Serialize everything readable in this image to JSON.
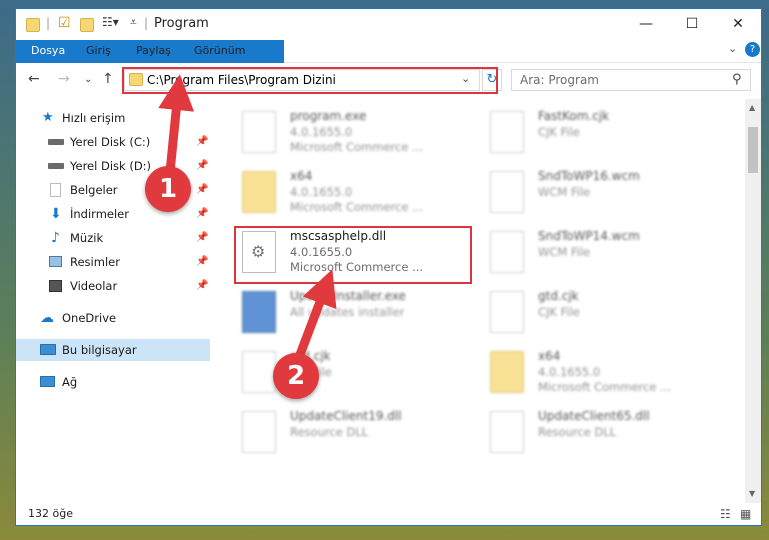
{
  "window": {
    "title": "Program"
  },
  "ribbon": {
    "tabs": [
      "Dosya",
      "Giriş",
      "Paylaş",
      "Görünüm"
    ]
  },
  "address": {
    "path": "C:\\Program Files\\Program Dizini"
  },
  "search": {
    "placeholder": "Ara: Program"
  },
  "sidebar": {
    "items": [
      {
        "label": "Hızlı erişim",
        "pinned": false
      },
      {
        "label": "Yerel Disk (C:)",
        "pinned": true
      },
      {
        "label": "Yerel Disk (D:)",
        "pinned": true
      },
      {
        "label": "Belgeler",
        "pinned": true
      },
      {
        "label": "İndirmeler",
        "pinned": true
      },
      {
        "label": "Müzik",
        "pinned": true
      },
      {
        "label": "Resimler",
        "pinned": true
      },
      {
        "label": "Videolar",
        "pinned": true
      },
      {
        "label": "OneDrive",
        "pinned": false
      },
      {
        "label": "Bu bilgisayar",
        "pinned": false,
        "selected": true
      },
      {
        "label": "Ağ",
        "pinned": false
      }
    ]
  },
  "files": [
    {
      "name": "program.exe",
      "line2": "4.0.1655.0",
      "line3": "Microsoft Commerce ...",
      "icon": "exe",
      "highlight": false
    },
    {
      "name": "FastKom.cjk",
      "line2": "CJK File",
      "line3": "",
      "icon": "doc",
      "highlight": false
    },
    {
      "name": "x64",
      "line2": "4.0.1655.0",
      "line3": "Microsoft Commerce ...",
      "icon": "folder",
      "highlight": false
    },
    {
      "name": "SndToWP16.wcm",
      "line2": "WCM File",
      "line3": "",
      "icon": "doc",
      "highlight": false
    },
    {
      "name": "mscsasphelp.dll",
      "line2": "4.0.1655.0",
      "line3": "Microsoft Commerce ...",
      "icon": "dll",
      "highlight": true
    },
    {
      "name": "SndToWP14.wcm",
      "line2": "WCM File",
      "line3": "",
      "icon": "doc",
      "highlight": false
    },
    {
      "name": "UpdateInstaller.exe",
      "line2": "All updates installer",
      "line3": "",
      "icon": "exe",
      "highlight": false
    },
    {
      "name": "gtd.cjk",
      "line2": "CJK File",
      "line3": "",
      "icon": "doc",
      "highlight": false
    },
    {
      "name": "gtd.cjk",
      "line2": "CJK File",
      "line3": "",
      "icon": "doc",
      "highlight": false
    },
    {
      "name": "x64",
      "line2": "4.0.1655.0",
      "line3": "Microsoft Commerce ...",
      "icon": "folder",
      "highlight": false
    },
    {
      "name": "UpdateClient19.dll",
      "line2": "Resource DLL",
      "line3": "",
      "icon": "dll",
      "highlight": false
    },
    {
      "name": "UpdateClient65.dll",
      "line2": "Resource DLL",
      "line3": "",
      "icon": "dll",
      "highlight": false
    }
  ],
  "status": {
    "count": "132 öğe"
  },
  "annotations": {
    "step1": "1",
    "step2": "2"
  },
  "colors": {
    "accent": "#1979ca",
    "highlight": "#d9363e",
    "selected": "#cce4f7"
  }
}
